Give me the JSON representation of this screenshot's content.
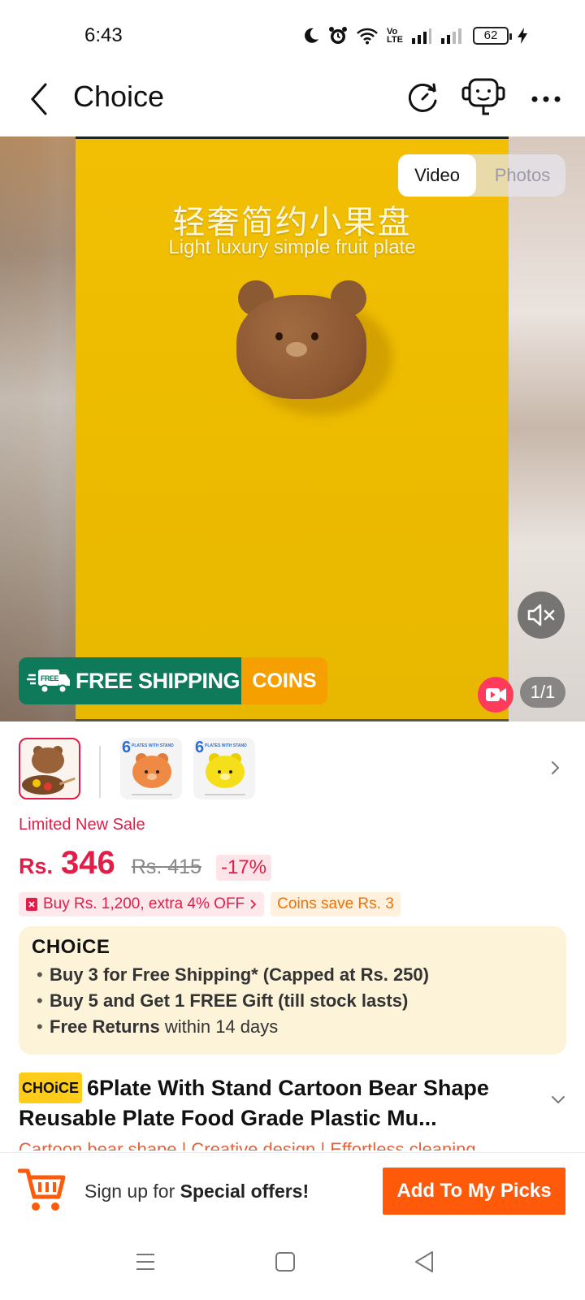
{
  "status_bar": {
    "time": "6:43",
    "battery": "62",
    "volte": "Vo\nLTE"
  },
  "header": {
    "title": "Choice"
  },
  "media": {
    "toggle": {
      "video": "Video",
      "photos": "Photos"
    },
    "video_caption_cn": "轻奢简约小果盘",
    "video_caption_en": "Light luxury simple fruit plate",
    "free_shipping_label": "FREE SHIPPING",
    "free_icon_label": "FREE",
    "coins_label": "COINS",
    "counter": "1/1"
  },
  "thumbnails": [
    {
      "name": "thumb-bear-plate-photo",
      "caption": ""
    },
    {
      "name": "thumb-orange-plate",
      "number": "6",
      "caption": "PLATES WITH STAND"
    },
    {
      "name": "thumb-yellow-plate",
      "number": "6",
      "caption": "PLATES WITH STAND"
    }
  ],
  "price": {
    "sale_label": "Limited New Sale",
    "currency": "Rs.",
    "value": "346",
    "old_price": "Rs. 415",
    "discount": "-17%"
  },
  "promos": {
    "extra_off": "Buy Rs. 1,200, extra 4% OFF",
    "coins_save": "Coins save Rs. 3"
  },
  "choice_box": {
    "logo": "CHOiCE",
    "line1": "Buy 3 for  Free Shipping* (Capped at Rs. 250)",
    "line2": "Buy 5 and Get 1 FREE Gift (till stock lasts)",
    "line3_bold": "Free Returns",
    "line3_rest": " within 14 days"
  },
  "product": {
    "badge": "CHOiCE",
    "title": "6Plate With Stand Cartoon Bear Shape Reusable Plate Food Grade Plastic Mu...",
    "tags": "Cartoon bear shape  |  Creative design  |  Effortless cleaning"
  },
  "bottom_bar": {
    "signup_prefix": "Sign up for ",
    "signup_bold": "Special offers!",
    "picks_button": "Add To My Picks"
  },
  "colors": {
    "accent_red": "#e11d48",
    "cta_orange": "#ff5a0a",
    "free_ship_green": "#0e7a5a",
    "coins_orange": "#f5a000",
    "video_yellow": "#e9b800",
    "choice_bg": "#fdf3d8"
  }
}
